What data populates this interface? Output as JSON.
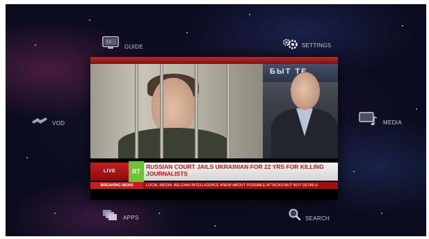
{
  "menu": {
    "guide": {
      "label": "GUIDE",
      "icon": "tv-icon"
    },
    "settings": {
      "label": "SETTINGS",
      "icon": "gear-icon"
    },
    "vod": {
      "label": "VOD",
      "icon": "satellite-icon"
    },
    "media": {
      "label": "MEDIA",
      "icon": "music-monitor-icon"
    },
    "apps": {
      "label": "APPS",
      "icon": "apps-stack-icon"
    },
    "search": {
      "label": "SEARCH",
      "icon": "magnifier-icon"
    }
  },
  "preview": {
    "live_badge": "LIVE",
    "channel_logo": "RT",
    "headline": "RUSSIAN COURT JAILS UKRAINIAN FOR 22 YRS FOR KILLING JOURNALISTS",
    "breaking_label": "BREAKING NEWS",
    "ticker_text": "LOCAL MEDIA: BELGIAN INTELLIGENCE KNEW ABOUT POSSIBLE ATTACKS BUT NOT DETAILS",
    "background_sign": "БЫТ   ТЕ"
  },
  "colors": {
    "accent_red": "#c51515",
    "live_green": "#2fae2f",
    "channel_green": "#6ec23b",
    "background": "#0b0c1e"
  }
}
